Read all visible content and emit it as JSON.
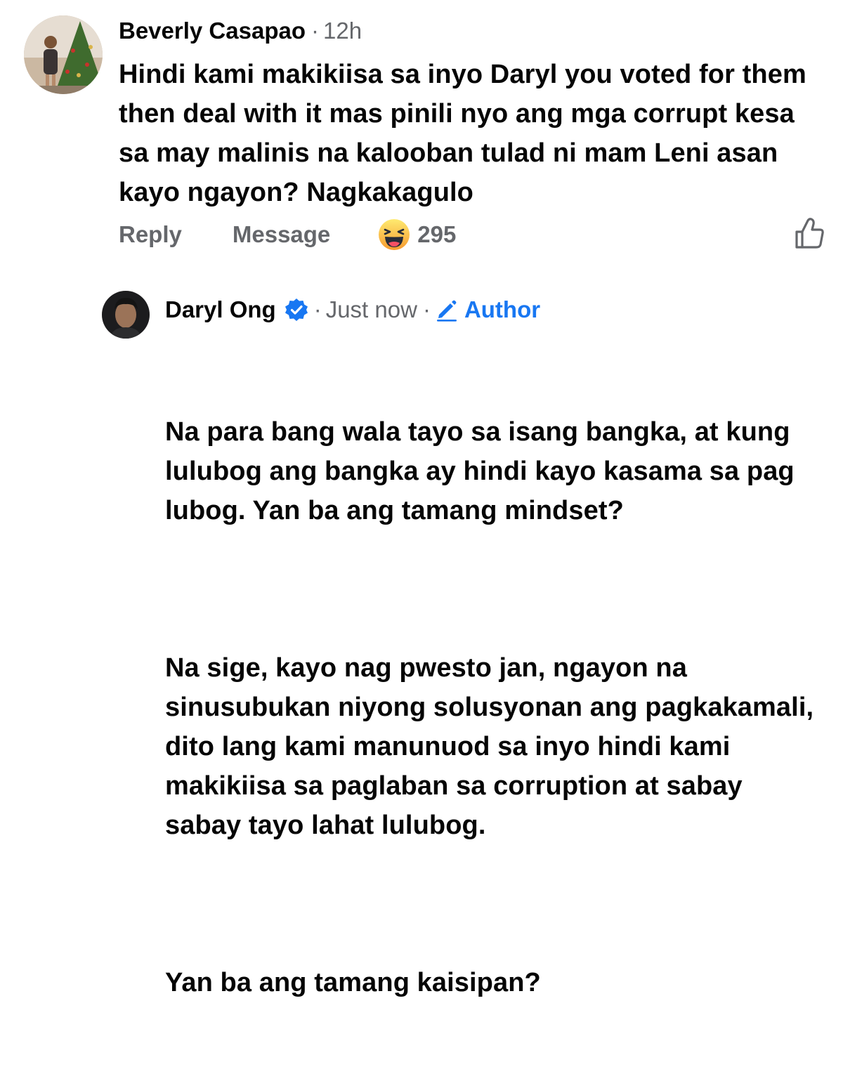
{
  "comment": {
    "author": "Beverly Casapao",
    "separator": "·",
    "time": "12h",
    "text": "Hindi kami makikiisa sa inyo Daryl you voted for them then deal with it mas pinili nyo ang mga corrupt kesa sa may malinis na kalooban tulad ni mam Leni asan kayo ngayon? Nagkakagulo",
    "actions": {
      "reply": "Reply",
      "message": "Message",
      "reaction_icon": "haha-emoji-icon",
      "reaction_count": "295",
      "like_icon": "thumbs-up-icon"
    }
  },
  "reply": {
    "author": "Daryl Ong",
    "verified_icon": "verified-badge-icon",
    "separator": "·",
    "time": "Just now",
    "badge_icon": "pencil-icon",
    "badge_label": "Author",
    "paragraphs": [
      "Na para bang wala tayo sa isang bangka, at kung lulubog ang bangka ay hindi kayo kasama sa pag lubog. Yan ba ang tamang mindset?",
      "Na sige, kayo nag pwesto jan, ngayon na sinusubukan niyong solusyonan ang pagkakamali, dito lang kami manunuod sa inyo hindi kami makikiisa sa paglaban sa corruption at sabay sabay tayo lahat lulubog.",
      "Yan ba ang tamang kaisipan?"
    ]
  },
  "colors": {
    "text_primary": "#050505",
    "text_secondary": "#65676b",
    "accent_blue": "#1877f2"
  }
}
